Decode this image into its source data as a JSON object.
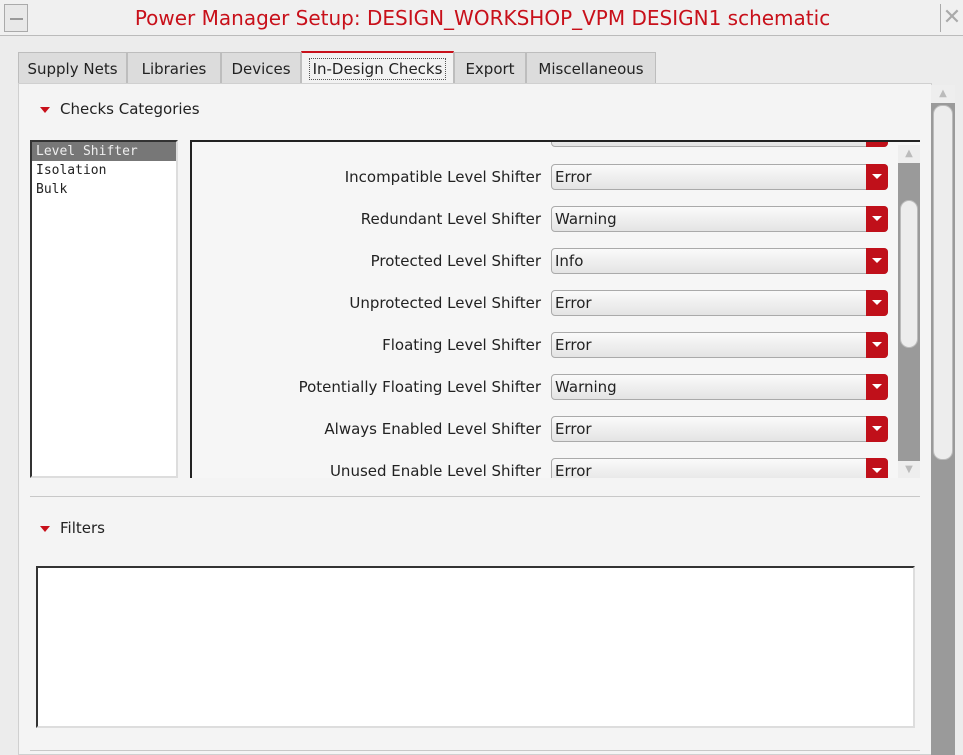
{
  "window": {
    "title": "Power Manager Setup: DESIGN_WORKSHOP_VPM DESIGN1 schematic",
    "close": "✕"
  },
  "tabs": [
    "Supply Nets",
    "Libraries",
    "Devices",
    "In-Design Checks",
    "Export",
    "Miscellaneous"
  ],
  "active_tab": "In-Design Checks",
  "checks_section": {
    "title": "Checks Categories",
    "categories": [
      "Level Shifter",
      "Isolation",
      "Bulk"
    ],
    "selected": "Level Shifter",
    "rows": [
      {
        "label": "Incompatible Level Shifter",
        "value": "Error"
      },
      {
        "label": "Redundant Level Shifter",
        "value": "Warning"
      },
      {
        "label": "Protected Level Shifter",
        "value": "Info"
      },
      {
        "label": "Unprotected Level Shifter",
        "value": "Error"
      },
      {
        "label": "Floating Level Shifter",
        "value": "Error"
      },
      {
        "label": "Potentially Floating Level Shifter",
        "value": "Warning"
      },
      {
        "label": "Always Enabled Level Shifter",
        "value": "Error"
      },
      {
        "label": "Unused Enable Level Shifter",
        "value": "Error"
      }
    ]
  },
  "filters_section": {
    "title": "Filters"
  },
  "colors": {
    "accent": "#c8101a"
  }
}
